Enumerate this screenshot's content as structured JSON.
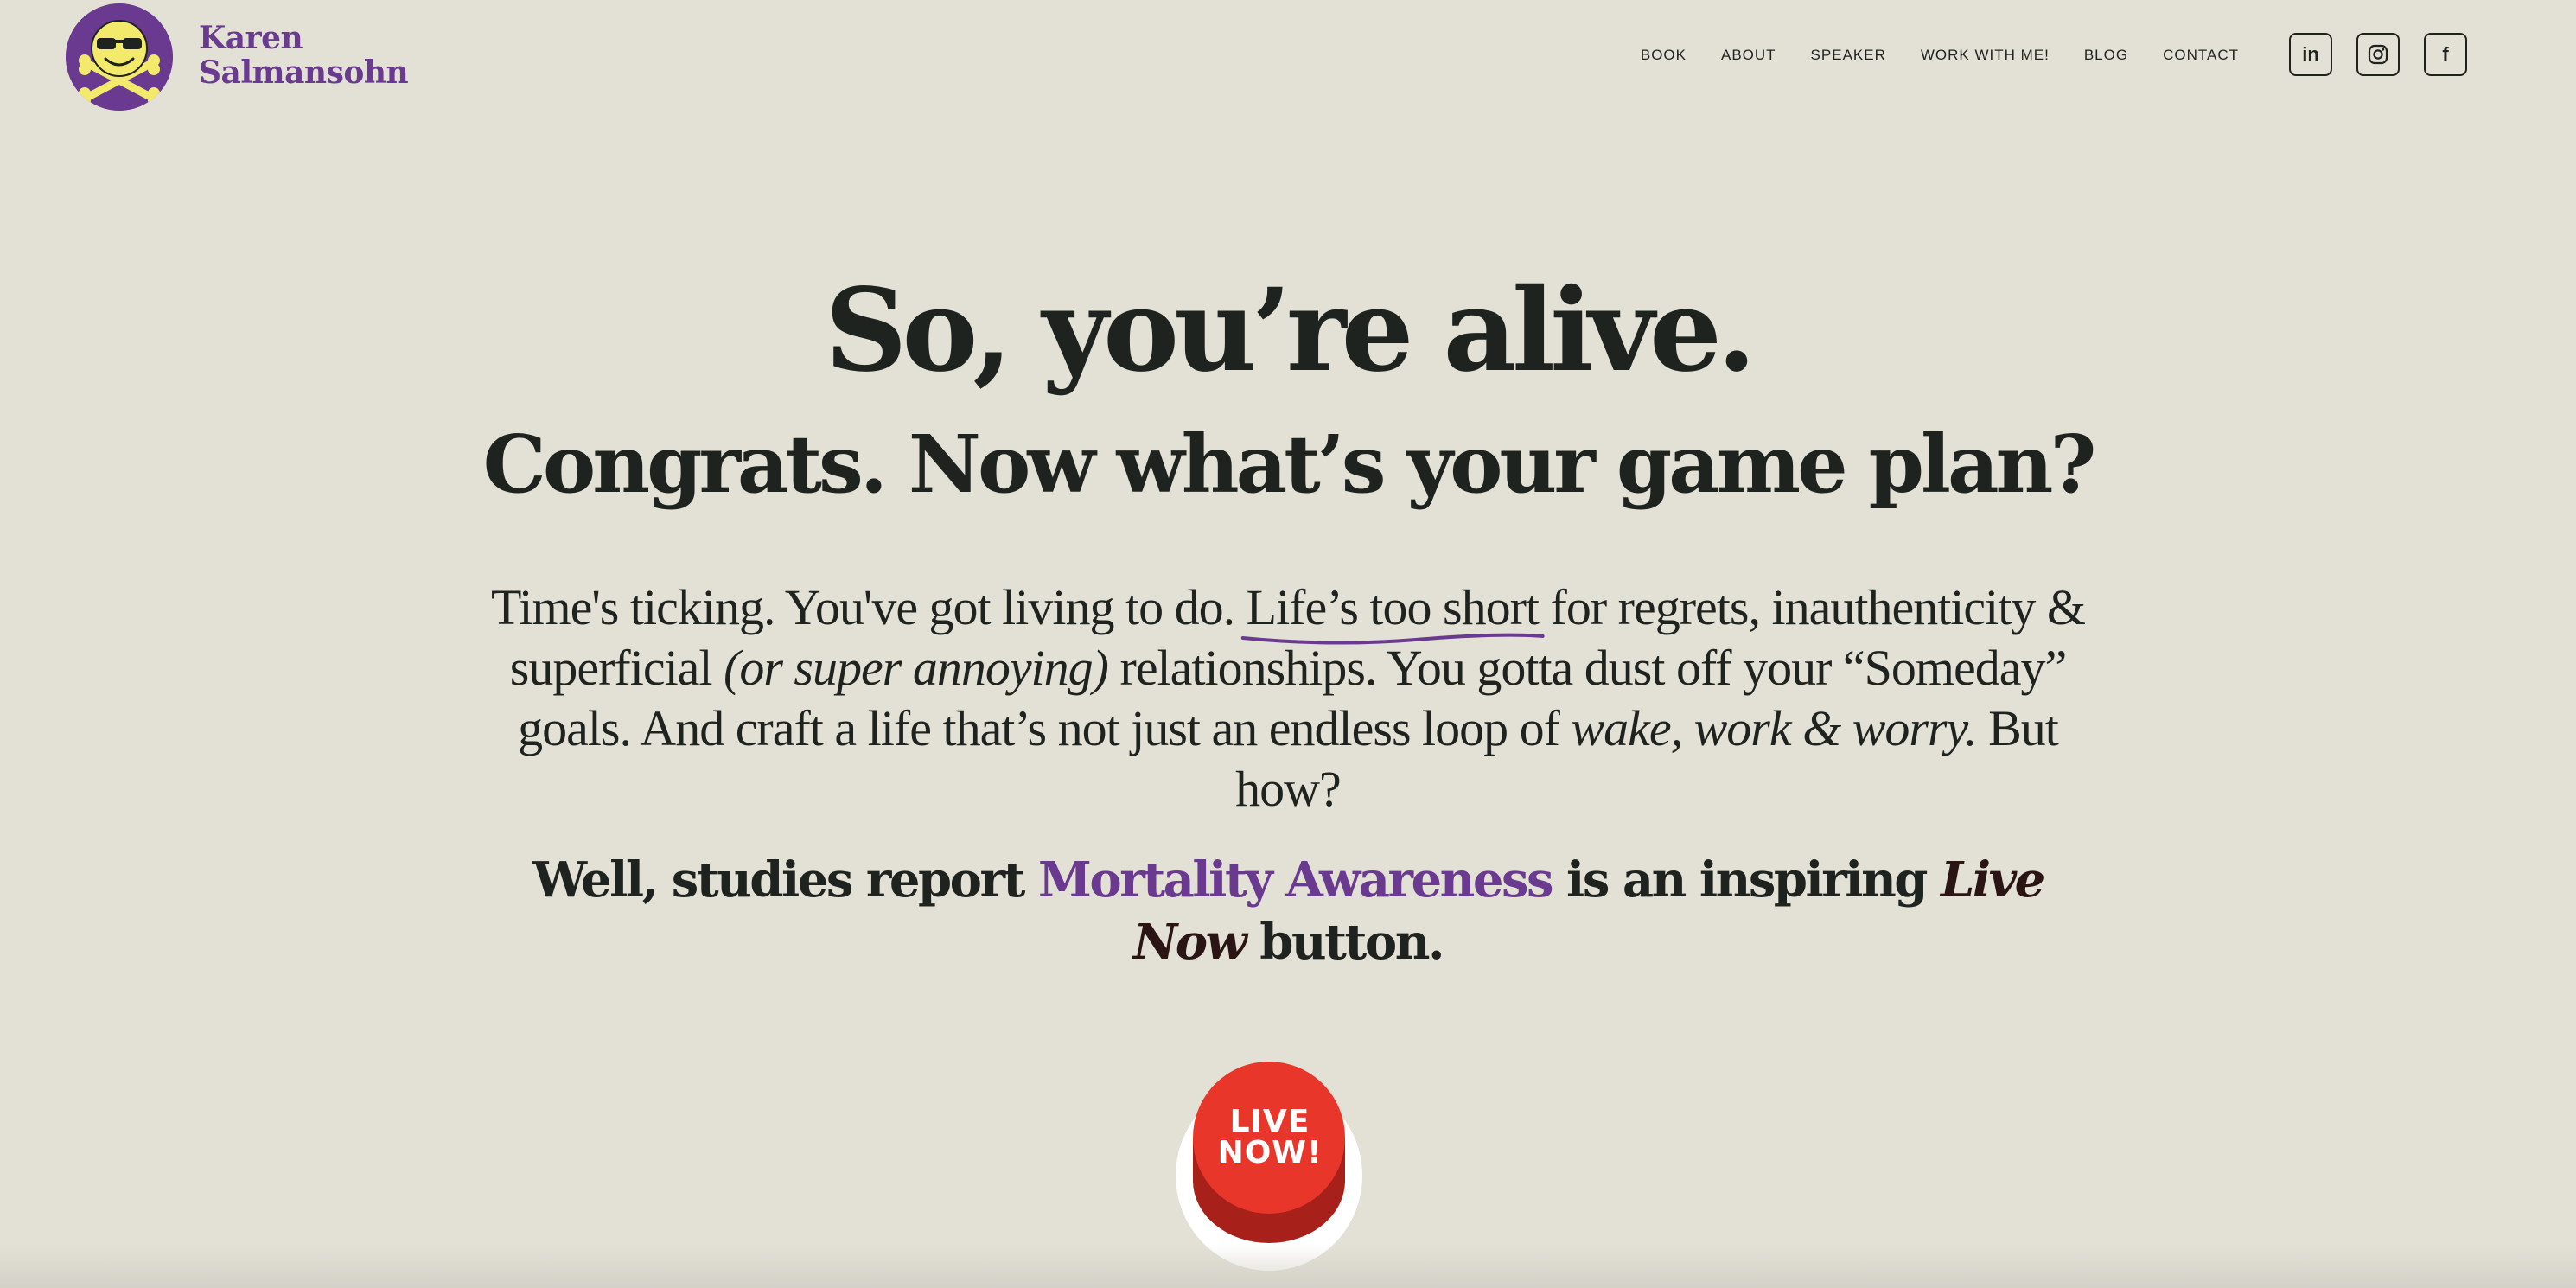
{
  "brand": {
    "name_line1": "Karen",
    "name_line2": "Salmansohn",
    "color": "#6a3a91"
  },
  "nav": {
    "items": [
      "BOOK",
      "ABOUT",
      "SPEAKER",
      "WORK WITH ME!",
      "BLOG",
      "CONTACT"
    ]
  },
  "socials": [
    {
      "name": "linkedin-icon",
      "label": "in"
    },
    {
      "name": "instagram-icon",
      "label": ""
    },
    {
      "name": "facebook-icon",
      "label": "f"
    }
  ],
  "hero": {
    "headline": "So, you’re alive.",
    "subheadline": "Congrats.  Now what’s your game plan?",
    "intro": {
      "part1": "Time's ticking. You've got living to do. ",
      "underlined": "Life’s too short",
      "part2": " for regrets, inauthenticity & superficial ",
      "italic1": "(or super annoying)",
      "part3": " relationships. You gotta dust off your “Someday” goals. And craft a life that’s not just an endless loop of ",
      "italic2": "wake, work & worry.",
      "part4": "   But how?"
    },
    "callout": {
      "part1": "Well,  studies report ",
      "accent": "Mortality Awareness",
      "part2": " is an inspiring ",
      "italic": "Live Now",
      "part3": " button."
    }
  },
  "live_button": {
    "line1": "LIVE",
    "line2": "NOW!",
    "color": "#e8362a"
  },
  "colors": {
    "background": "#e3e1d6",
    "text": "#1f231f",
    "accent": "#6a3a91"
  }
}
